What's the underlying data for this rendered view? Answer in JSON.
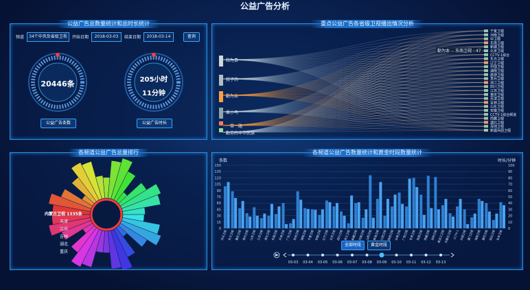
{
  "page_title": "公益广告分析",
  "panel1": {
    "title": "公益广告总数量统计和总时长统计",
    "channel_label": "频道",
    "channel_value": "34个中央及省级卫视",
    "start_label": "开始日期",
    "start_value": "2018-03-03",
    "end_label": "结束日期",
    "end_value": "2018-03-14",
    "query_button": "查询",
    "gauge1_value": "20446条",
    "gauge2_value_line1": "205小时",
    "gauge2_value_line2": "11分钟",
    "gauge1_button": "公益广告条数",
    "gauge2_button": "公益广告时长"
  },
  "panel2": {
    "title": "重点公益广告各省级卫视播出情况分析",
    "tooltip": "勤为本 -- 东南卫视 : 47",
    "sources": [
      "和为贵",
      "孩子的",
      "勤为本",
      "乘小鸟",
      "一带一路",
      "勤劳的中华民族"
    ],
    "targets": [
      "宁夏卫视",
      "河南卫视",
      "中卫视",
      "东南卫视",
      "新疆卫视",
      "北京卫视",
      "CCTV-1综合",
      "东方卫视",
      "辽宁卫视",
      "中国卫视",
      "湖南卫视",
      "旅游卫视",
      "贵州卫视",
      "浙江卫视",
      "四川卫视",
      "江苏卫视",
      "重庆卫视",
      "天津卫视",
      "吉林卫视",
      "山东卫视",
      "安徽卫视",
      "CCTV-1综合频道",
      "西藏卫视",
      "湖北卫视",
      "深圳卫视",
      "新疆兵团卫视"
    ]
  },
  "panel3": {
    "title": "各频道公益广告总量排行",
    "highlight_label": "内蒙古卫视 1335条",
    "left_labels": [
      "天津",
      "江苏",
      "吉林",
      "湖北",
      "重庆"
    ]
  },
  "panel4": {
    "title": "各频道公益广告数量统计和黄金时段数量统计",
    "left_axis_title": "条数",
    "right_axis_title": "时长/分钟",
    "button_all": "全部时段",
    "button_gold": "黄金时段",
    "dates": [
      "03-03",
      "03-04",
      "03-05",
      "03-06",
      "03-07",
      "03-08",
      "03-09",
      "03-10",
      "03-11",
      "03-12",
      "03-13"
    ],
    "active_date": "03-09"
  },
  "chart_data": {
    "type": "bar",
    "title": "各频道公益广告数量统计和黄金时段数量统计",
    "ylabel": "条数",
    "y2label": "时长/分钟",
    "ylim": [
      0,
      150
    ],
    "y2lim": [
      0,
      100
    ],
    "yticks": [
      0,
      15,
      30,
      45,
      60,
      75,
      90,
      105,
      120,
      135,
      150
    ],
    "y2ticks": [
      0,
      10,
      20,
      30,
      40,
      50,
      60,
      70,
      80,
      90,
      100
    ],
    "categories": [
      "河北卫视",
      "东方卫视",
      "重庆卫视",
      "贵州卫视",
      "山东卫视",
      "江苏卫视",
      "湖北卫视",
      "东南卫视",
      "天津卫视",
      "广东卫视",
      "吉林卫视",
      "湖南卫视",
      "宁夏卫视",
      "安徽卫视",
      "辽宁卫视",
      "北京卫视",
      "四川卫视",
      "浙江卫视",
      "新疆卫视",
      "河南卫视",
      "山西卫视",
      "青海卫视",
      "江西卫视",
      "陕西卫视",
      "云南卫视",
      "广西卫视",
      "甘肃卫视",
      "旅游卫视",
      "西藏卫视",
      "深圳卫视",
      "黑龙江卫视",
      "内蒙古卫视",
      "CCTV-1",
      "兵团卫视",
      "厦门卫视",
      "海南卫视",
      "康巴卫视",
      "延边卫视",
      "安多卫视"
    ],
    "series": [
      {
        "values": [
          100,
          88,
          48,
          36,
          50,
          24,
          30,
          34,
          60,
          12,
          88,
          48,
          45,
          32,
          66,
          52,
          40,
          12,
          60,
          25,
          126,
          70,
          30,
          52,
          85,
          52,
          120,
          80,
          125,
          122,
          55,
          36,
          52,
          45,
          26,
          70,
          60,
          20,
          62
        ]
      },
      {
        "values": [
          110,
          72,
          65,
          28,
          30,
          35,
          58,
          52,
          10,
          22,
          68,
          46,
          44,
          45,
          62,
          60,
          30,
          78,
          62,
          45,
          25,
          110,
          70,
          80,
          58,
          118,
          98,
          32,
          48,
          45,
          70,
          28,
          70,
          10,
          35,
          65,
          40,
          35,
          55
        ]
      }
    ]
  },
  "colors": {
    "bar_primary": "#2f7fd0",
    "bar_secondary": "#4aa3f0",
    "frame": "#2d8fd6",
    "accent_red": "#ff3a3a"
  }
}
